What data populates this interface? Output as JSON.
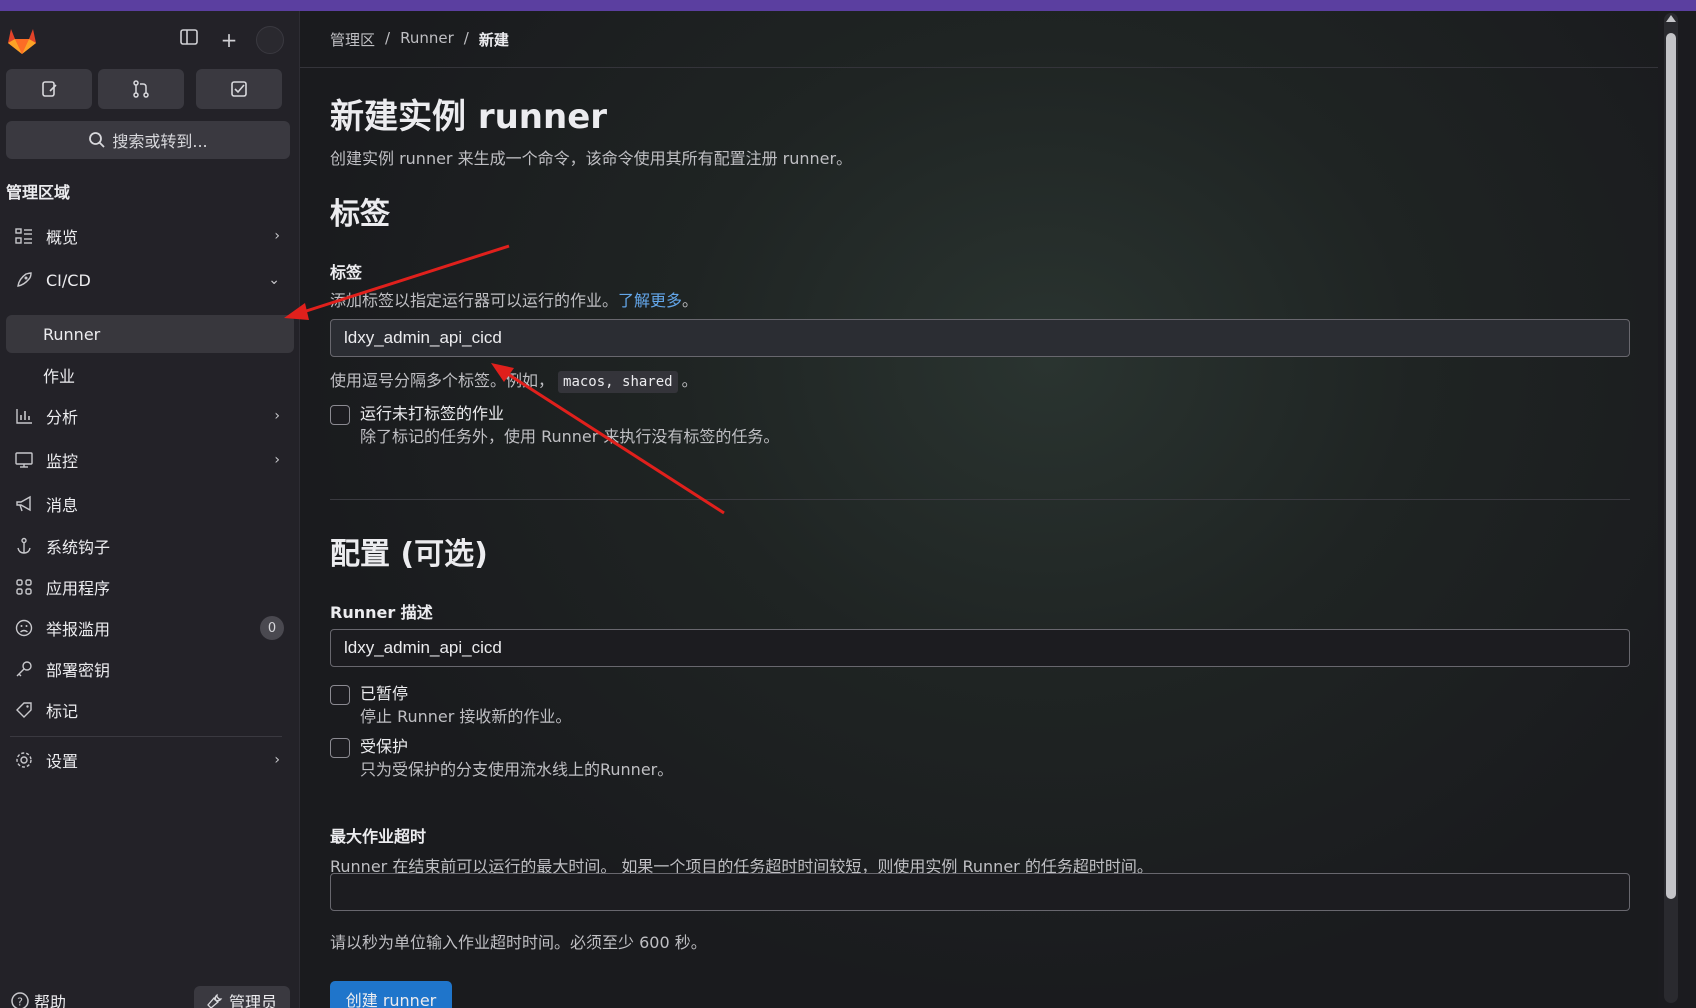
{
  "breadcrumb": {
    "items": [
      "管理区",
      "Runner"
    ],
    "current": "新建",
    "separator": "/"
  },
  "sidebar": {
    "search_label": "搜索或转到...",
    "heading": "管理区域",
    "items": [
      {
        "label": "概览",
        "icon": "overview-icon"
      },
      {
        "label": "CI/CD",
        "icon": "rocket-icon"
      },
      {
        "label": "Runner"
      },
      {
        "label": "作业"
      },
      {
        "label": "分析",
        "icon": "chart-icon"
      },
      {
        "label": "监控",
        "icon": "monitor-icon"
      },
      {
        "label": "消息",
        "icon": "megaphone-icon"
      },
      {
        "label": "系统钩子",
        "icon": "anchor-icon"
      },
      {
        "label": "应用程序",
        "icon": "apps-icon"
      },
      {
        "label": "举报滥用",
        "icon": "abuse-icon",
        "badge": "0"
      },
      {
        "label": "部署密钥",
        "icon": "key-icon"
      },
      {
        "label": "标记",
        "icon": "label-icon"
      },
      {
        "label": "设置",
        "icon": "settings-icon"
      }
    ],
    "help_label": "帮助",
    "admin_label": "管理员"
  },
  "main": {
    "title": "新建实例 runner",
    "description": "创建实例 runner 来生成一个命令，该命令使用其所有配置注册 runner。",
    "tags_section": {
      "heading": "标签",
      "label": "标签",
      "help": "添加标签以指定运行器可以运行的作业。",
      "help_link": "了解更多",
      "help_end": "。",
      "value": "ldxy_admin_api_cicd",
      "hint_prefix": "使用逗号分隔多个标签。例如，",
      "hint_code": "macos, shared",
      "hint_suffix": "。",
      "untagged_title": "运行未打标签的作业",
      "untagged_sub": "除了标记的任务外，使用 Runner 来执行没有标签的任务。"
    },
    "config_section": {
      "heading": "配置 (可选)",
      "desc_label": "Runner 描述",
      "desc_value": "ldxy_admin_api_cicd",
      "paused_title": "已暂停",
      "paused_sub": "停止 Runner 接收新的作业。",
      "protected_title": "受保护",
      "protected_sub": "只为受保护的分支使用流水线上的Runner。",
      "timeout_label": "最大作业超时",
      "timeout_help": "Runner 在结束前可以运行的最大时间。 如果一个项目的任务超时时间较短，则使用实例 Runner 的任务超时时间。",
      "timeout_value": "",
      "timeout_hint": "请以秒为单位输入作业超时时间。必须至少 600 秒。"
    },
    "create_button": "创建 runner"
  },
  "colors": {
    "accent": "#1f75cb",
    "topbar": "#5b3fa0",
    "arrow": "#e0201c",
    "link": "#63a6e9"
  }
}
